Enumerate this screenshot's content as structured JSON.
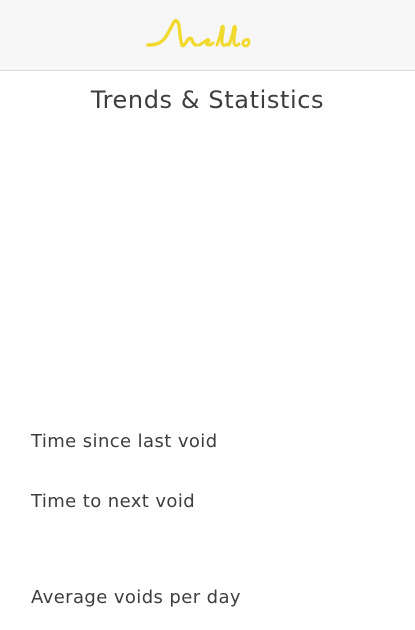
{
  "header": {
    "logo_text": "Mello",
    "logo_color": "#f2d92d",
    "logo_icon": "mello-wordmark-logo"
  },
  "page": {
    "title": "Trends & Statistics"
  },
  "stats": [
    {
      "label": "Time since last void"
    },
    {
      "label": "Time to next void"
    },
    {
      "label": "Average voids per day"
    }
  ]
}
